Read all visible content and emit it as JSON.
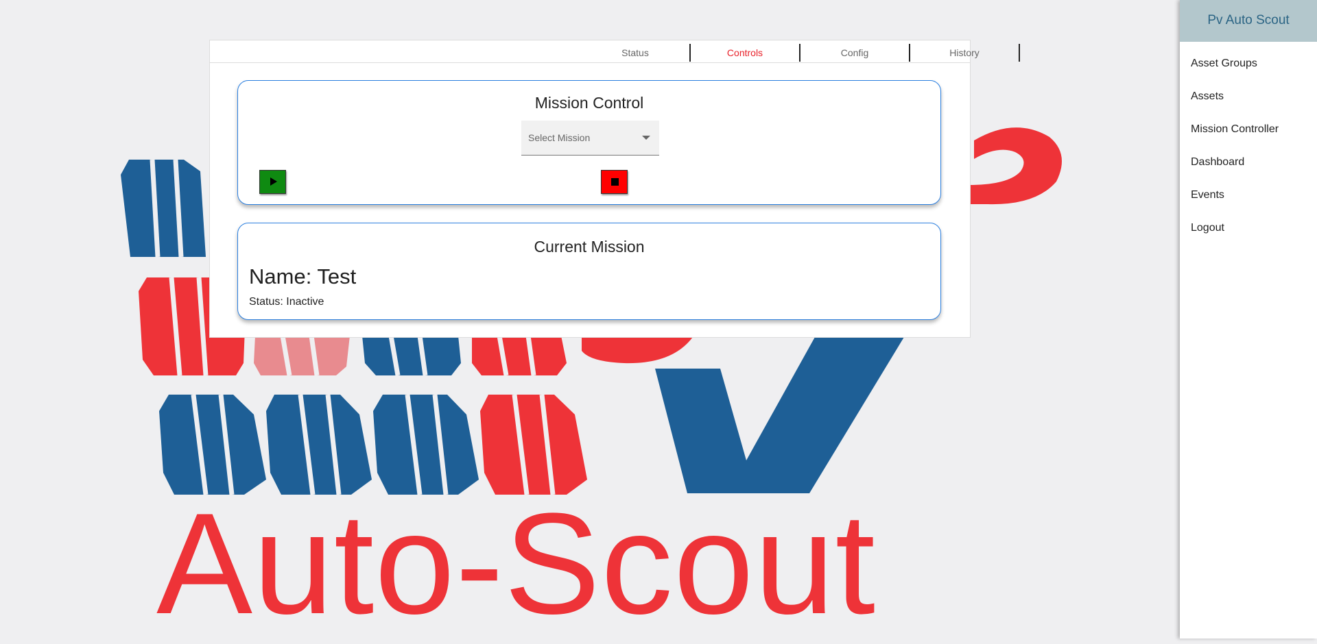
{
  "app": {
    "title": "Pv Auto Scout"
  },
  "background": {
    "logo_text": "Auto-Scout",
    "brand_red": "#ee3338",
    "brand_blue": "#1e5f96"
  },
  "tabs": [
    {
      "label": "Status",
      "active": false
    },
    {
      "label": "Controls",
      "active": true
    },
    {
      "label": "Config",
      "active": false
    },
    {
      "label": "History",
      "active": false
    }
  ],
  "mission_control": {
    "title": "Mission Control",
    "select_placeholder": "Select Mission",
    "start_icon": "play-icon",
    "stop_icon": "stop-icon"
  },
  "current_mission": {
    "title": "Current Mission",
    "name_line": "Name: Test",
    "status_line": "Status: Inactive"
  },
  "sidebar": {
    "items": [
      {
        "label": "Asset Groups"
      },
      {
        "label": "Assets"
      },
      {
        "label": "Mission Controller"
      },
      {
        "label": "Dashboard"
      },
      {
        "label": "Events"
      },
      {
        "label": "Logout"
      }
    ]
  }
}
